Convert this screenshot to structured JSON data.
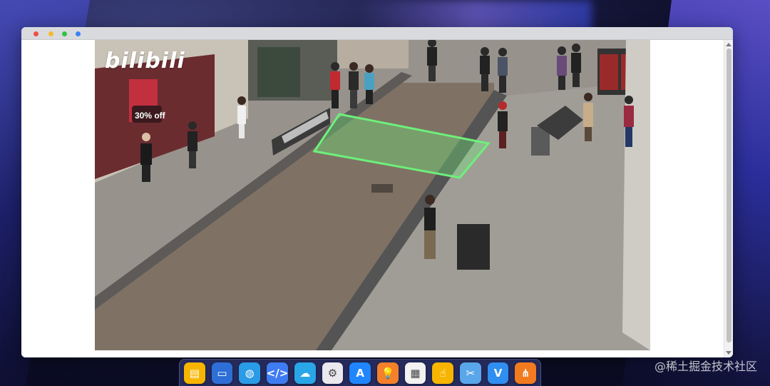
{
  "window": {
    "controls": [
      "close",
      "minimize",
      "maximize",
      "extra"
    ]
  },
  "video": {
    "brand_text": "bilibili",
    "shop_sign": "30% off",
    "zone_color": "#6df07a"
  },
  "dock": {
    "apps": [
      {
        "icon": "files-icon",
        "color": "#f7b500",
        "glyph": "▤"
      },
      {
        "icon": "terminal-icon",
        "color": "#2d6fd6",
        "glyph": "▭"
      },
      {
        "icon": "planet-browser-icon",
        "color": "#2a9be6",
        "glyph": "◍"
      },
      {
        "icon": "code-editor-icon",
        "color": "#3f7cf2",
        "glyph": "</>"
      },
      {
        "icon": "cloud-icon",
        "color": "#29a6e8",
        "glyph": "☁"
      },
      {
        "icon": "settings-icon",
        "color": "#e9e9ee",
        "glyph": "⚙"
      },
      {
        "icon": "app-store-icon",
        "color": "#1f86ff",
        "glyph": "A"
      },
      {
        "icon": "lightbulb-icon",
        "color": "#f3802b",
        "glyph": "💡"
      },
      {
        "icon": "calculator-icon",
        "color": "#f2f2f2",
        "glyph": "▦"
      },
      {
        "icon": "touch-icon",
        "color": "#f7b500",
        "glyph": "☝"
      },
      {
        "icon": "tools-icon",
        "color": "#5aa6ea",
        "glyph": "✂"
      },
      {
        "icon": "vue-icon",
        "color": "#2f8ef0",
        "glyph": "V"
      },
      {
        "icon": "share-nodes-icon",
        "color": "#f27b20",
        "glyph": "⋔"
      }
    ]
  },
  "watermark": "@稀土掘金技术社区"
}
